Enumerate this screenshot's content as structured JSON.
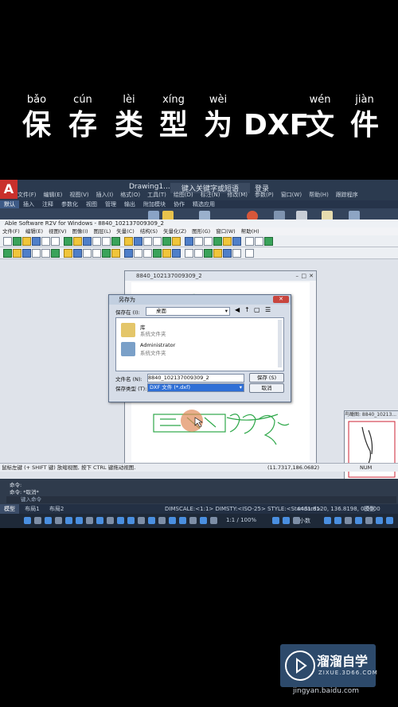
{
  "caption": {
    "chars": [
      {
        "pinyin": "bǎo",
        "hanzi": "保"
      },
      {
        "pinyin": "cún",
        "hanzi": "存"
      },
      {
        "pinyin": "lèi",
        "hanzi": "类"
      },
      {
        "pinyin": "xíng",
        "hanzi": "型"
      },
      {
        "pinyin": "wèi",
        "hanzi": "为"
      },
      {
        "pinyin": "",
        "hanzi": "DXF"
      },
      {
        "pinyin": "wén",
        "hanzi": "文"
      },
      {
        "pinyin": "jiàn",
        "hanzi": "件"
      }
    ]
  },
  "autocad": {
    "logo": "A",
    "doc_title": "Drawing1...",
    "search_placeholder": "键入关键字或短语",
    "login": "登录",
    "menu": [
      "文件(F)",
      "编辑(E)",
      "视图(V)",
      "插入(I)",
      "格式(O)",
      "工具(T)",
      "绘图(D)",
      "标注(N)",
      "修改(M)",
      "参数(P)",
      "窗口(W)",
      "帮助(H)",
      "跟踪程序"
    ],
    "ribbon_tabs": [
      "默认",
      "插入",
      "注释",
      "参数化",
      "视图",
      "管理",
      "输出",
      "附加模块",
      "协作",
      "精选应用"
    ],
    "command_lines": [
      "命令:",
      "命令: *取消*"
    ],
    "command_placeholder": "键入命令",
    "layout_tabs": [
      "模型",
      "布局1",
      "布局2"
    ],
    "status_dim": "DIMSCALE:<1:1> DIMSTY:<ISO-25> STYLE:<Standard>",
    "coords": "4431.8120, 136.8198, 0.0000",
    "model_label": "模型",
    "scale": "1:1 / 100%",
    "units": "小数"
  },
  "able": {
    "title": "Able Software R2V for Windows - 8840_102137009309_2",
    "menu": [
      "文件(F)",
      "编辑(E)",
      "视图(V)",
      "图像(I)",
      "图层(L)",
      "矢量(C)",
      "结构(S)",
      "矢量化(Z)",
      "图形(G)",
      "窗口(W)",
      "帮助(H)"
    ],
    "layer_value": "0",
    "doc_window_title": "8840_102137009309_2",
    "thumb_title": "鸟瞰图: 8840_10213...",
    "status_left": "鼠标左键 (+ SHIFT 键) 放缩视图, 按下 CTRL 键拖动视图.",
    "status_coords": "(11.7317,186.0682)",
    "status_num": "NUM"
  },
  "save_dialog": {
    "title": "另存为",
    "close": "✕",
    "savein_label": "保存在 (I):",
    "savein_value": "桌面",
    "items": [
      {
        "name": "库",
        "sub": "系统文件夹"
      },
      {
        "name": "Administrator",
        "sub": "系统文件夹"
      }
    ],
    "filename_label": "文件名 (N):",
    "filename_value": "8840_102137009309_2",
    "filetype_label": "保存类型 (T):",
    "filetype_value": "DXF 文件 (*.dxf)",
    "save_button": "保存 (S)",
    "cancel_button": "取消"
  },
  "watermark": {
    "brand": "溜溜自学",
    "sub": "ZIXUE.3D66.COM",
    "site": "jingyan.baidu.com"
  },
  "colors": {
    "acad_dark": "#2b3a4f",
    "caption_text": "#ffffff",
    "selection_blue": "#2f6fd6",
    "drawing_green": "#2fa84a"
  }
}
